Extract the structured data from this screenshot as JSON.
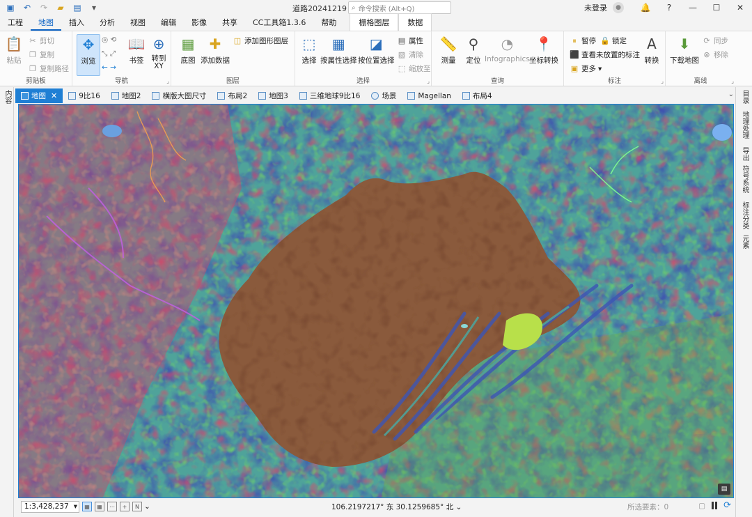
{
  "titlebar": {
    "title": "道路20241219",
    "search_placeholder": "命令搜索 (Alt+Q)",
    "login": "未登录",
    "help": "?"
  },
  "menus": [
    "工程",
    "地图",
    "插入",
    "分析",
    "视图",
    "编辑",
    "影像",
    "共享",
    "CC工具箱1.3.6",
    "帮助",
    "栅格图层",
    "数据"
  ],
  "active_menu": "地图",
  "ribbon": {
    "clipboard": {
      "label": "剪贴板",
      "paste": "粘贴",
      "cut": "剪切",
      "copy": "复制",
      "copy_path": "复制路径"
    },
    "navigate": {
      "label": "导航",
      "explore": "浏览",
      "bookmarks": "书签",
      "goto_xy": "转到\nXY"
    },
    "layer": {
      "label": "图层",
      "basemap": "底图",
      "add_data": "添加数据",
      "add_graphics": "添加图形图层"
    },
    "selection": {
      "label": "选择",
      "select": "选择",
      "by_attr": "按属性选择",
      "by_loc": "按位置选择",
      "attributes": "属性",
      "clear": "清除",
      "zoom_to": "缩放至"
    },
    "inquiry": {
      "label": "查询",
      "measure": "测量",
      "locate": "定位",
      "infographics": "Infographics",
      "coord_conv": "坐标转换"
    },
    "labeling": {
      "label": "标注",
      "pause": "暂停",
      "lock": "锁定",
      "view_unplaced": "查看未放置的标注",
      "more": "更多",
      "convert": "转换"
    },
    "offline": {
      "label": "离线",
      "download_map": "下载地图",
      "sync": "同步",
      "remove": "移除"
    }
  },
  "left_panel": "内容",
  "tabs": [
    {
      "label": "地图",
      "active": true
    },
    {
      "label": "9比16"
    },
    {
      "label": "地图2"
    },
    {
      "label": "横版大图尺寸"
    },
    {
      "label": "布局2"
    },
    {
      "label": "地图3"
    },
    {
      "label": "三维地球9比16"
    },
    {
      "label": "场景"
    },
    {
      "label": "Magellan"
    },
    {
      "label": "布局4"
    }
  ],
  "right_panels": [
    "目录",
    "地理处理",
    "导出",
    "符号系统",
    "标注分类",
    "元素"
  ],
  "status": {
    "scale": "1:3,428,237",
    "coords": "106.2197217° 东  30.1259685° 北",
    "selected_features": "所选要素：0"
  },
  "colors": {
    "accent": "#1f7fd4",
    "basin": "#8a5a3c"
  }
}
